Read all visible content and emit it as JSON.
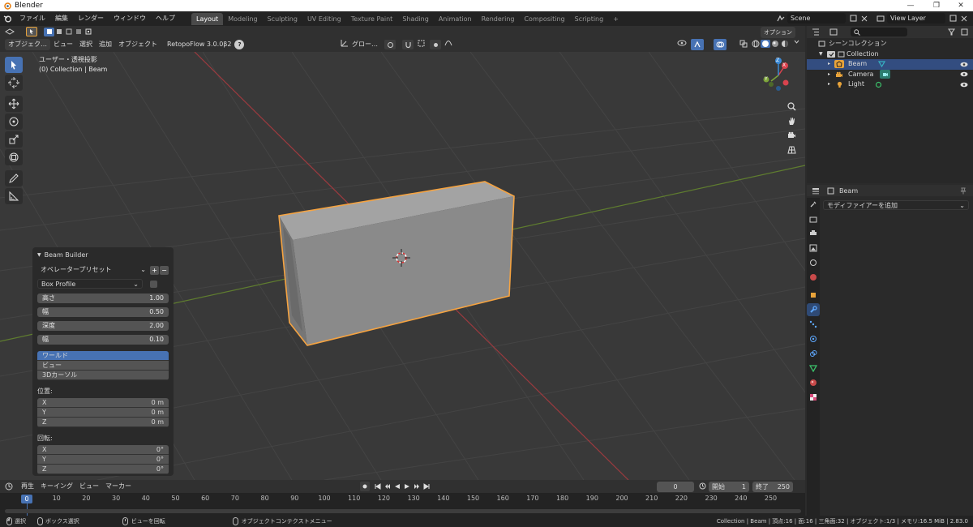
{
  "window": {
    "title": "Blender",
    "min": "—",
    "max": "❐",
    "close": "✕"
  },
  "menu": {
    "file": "ファイル",
    "edit": "編集",
    "render": "レンダー",
    "window": "ウィンドウ",
    "help": "ヘルプ"
  },
  "workspaces": [
    "Layout",
    "Modeling",
    "Sculpting",
    "UV Editing",
    "Texture Paint",
    "Shading",
    "Animation",
    "Rendering",
    "Compositing",
    "Scripting"
  ],
  "add_workspace": "+",
  "scene": {
    "name": "Scene",
    "view_layer": "View Layer"
  },
  "vp_header": {
    "mode": "オブジェク…",
    "view": "ビュー",
    "select": "選択",
    "add": "追加",
    "object": "オブジェクト",
    "addon": "RetopoFlow 3.0.0β2",
    "help": "?",
    "transform_orient": "グロー…",
    "options": "オプション"
  },
  "viewport": {
    "view_name": "ユーザー・透視投影",
    "collection_info": "(0) Collection | Beam",
    "gizmo": {
      "x": "X",
      "y": "Y",
      "z": "Z"
    }
  },
  "operator_panel": {
    "title": "Beam Builder",
    "preset": "オペレータープリセット",
    "preset_add": "+",
    "preset_remove": "−",
    "profile": "Box Profile",
    "fields": [
      {
        "label": "高さ",
        "value": "1.00"
      },
      {
        "label": "幅",
        "value": "0.50"
      },
      {
        "label": "深度",
        "value": "2.00"
      },
      {
        "label": "幅",
        "value": "0.10"
      }
    ],
    "align": {
      "options": [
        "ワールド",
        "ビュー",
        "3Dカーソル"
      ],
      "selected": "ワールド"
    },
    "location": {
      "label": "位置:",
      "x": {
        "label": "X",
        "value": "0 m"
      },
      "y": {
        "label": "Y",
        "value": "0 m"
      },
      "z": {
        "label": "Z",
        "value": "0 m"
      }
    },
    "rotation": {
      "label": "回転:",
      "x": {
        "label": "X",
        "value": "0°"
      },
      "y": {
        "label": "Y",
        "value": "0°"
      },
      "z": {
        "label": "Z",
        "value": "0°"
      }
    }
  },
  "outliner": {
    "root": "シーンコレクション",
    "collection": "Collection",
    "items": [
      {
        "name": "Beam",
        "selected": true
      },
      {
        "name": "Camera",
        "selected": false
      },
      {
        "name": "Light",
        "selected": false
      }
    ]
  },
  "properties": {
    "object": "Beam",
    "add_modifier": "モディファイアーを追加"
  },
  "timeline": {
    "playback": "再生",
    "keying": "キーイング",
    "view": "ビュー",
    "marker": "マーカー",
    "current_frame": "0",
    "start_label": "開始",
    "start": "1",
    "end_label": "終了",
    "end": "250",
    "ticks": [
      "0",
      "10",
      "20",
      "30",
      "40",
      "50",
      "60",
      "70",
      "80",
      "90",
      "100",
      "110",
      "120",
      "130",
      "140",
      "150",
      "160",
      "170",
      "180",
      "190",
      "200",
      "210",
      "220",
      "230",
      "240",
      "250"
    ]
  },
  "status": {
    "select": "選択",
    "box_select": "ボックス選択",
    "rotate_view": "ビューを回転",
    "context_menu": "オブジェクトコンテクストメニュー",
    "stats": "Collection | Beam | 頂点:16 | 面:16 | 三角面:32 | オブジェクト:1/3 | メモリ:16.5 MiB | 2.83.0"
  },
  "colors": {
    "accent": "#4772b3",
    "select_orange": "#f5a341",
    "axis_x": "#d9434e",
    "axis_y": "#7ca43a",
    "axis_z": "#3b8ad6"
  }
}
